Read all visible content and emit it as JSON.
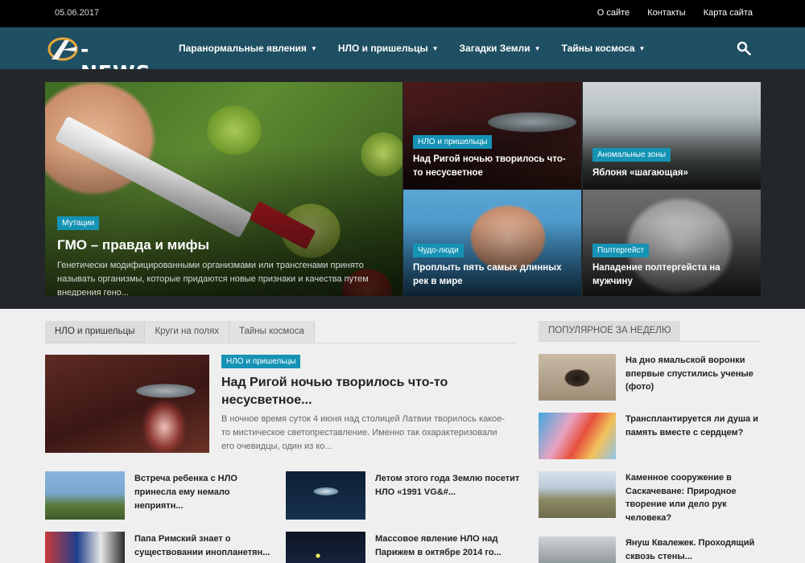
{
  "topbar": {
    "date": "05.06.2017",
    "links": [
      "О сайте",
      "Контакты",
      "Карта сайта"
    ]
  },
  "nav": {
    "logo_text": "-NEWS",
    "menu": [
      "Паранормальные явления",
      "НЛО и пришельцы",
      "Загадки Земли",
      "Тайны космоса"
    ],
    "search_icon": "search-icon"
  },
  "hero": {
    "main": {
      "category": "Мутации",
      "title": "ГМО – правда и мифы",
      "excerpt": "Генетически модифицированными организмами или трансгенами принято называть организмы, которые придаются новые признаки и качества путем внедрения гено..."
    },
    "tiles": [
      {
        "category": "НЛО и пришельцы",
        "title": "Над Ригой ночью творилось что-то несусветное"
      },
      {
        "category": "Аномальные зоны",
        "title": "Яблоня «шагающая»"
      },
      {
        "category": "Чудо-люди",
        "title": "Проплыть пять самых длинных рек в мире"
      },
      {
        "category": "Полтергейст",
        "title": "Нападение полтергейста на мужчину"
      }
    ]
  },
  "tabs": [
    "НЛО и пришельцы",
    "Круги на полях",
    "Тайны космоса"
  ],
  "featured": {
    "category": "НЛО и пришельцы",
    "title": "Над Ригой ночью творилось что-то несусветное...",
    "excerpt": "В ночное время суток 4 июня над столицей Латвии творилось какое-то мистическое светопреставление. Именно так охарактеризовали его очевидцы, один из ко..."
  },
  "mini_articles": [
    "Встреча ребенка с НЛО принесла ему немало неприятн...",
    "Летом этого года Землю посетит НЛО «1991 VG&#...",
    "Папа Римский знает о существовании инопланетян...",
    "Массовое явление НЛО над Парижем в октябре 2014 го..."
  ],
  "popular": {
    "heading": "ПОПУЛЯРНОЕ ЗА НЕДЕЛЮ",
    "items": [
      "На дно ямальской воронки впервые спустились ученые (фото)",
      "Трансплантируется ли душа и память вместе с сердцем?",
      "Каменное сооружение в Саскачеване: Природное творение или дело рук человека?",
      "Януш Квалежек. Проходящий сквозь стены..."
    ]
  },
  "colors": {
    "topbar": "#000000",
    "nav": "#1f4f63",
    "hero_bg": "#24272a",
    "category_badge": "#1593b5",
    "page_bg": "#efefef"
  }
}
